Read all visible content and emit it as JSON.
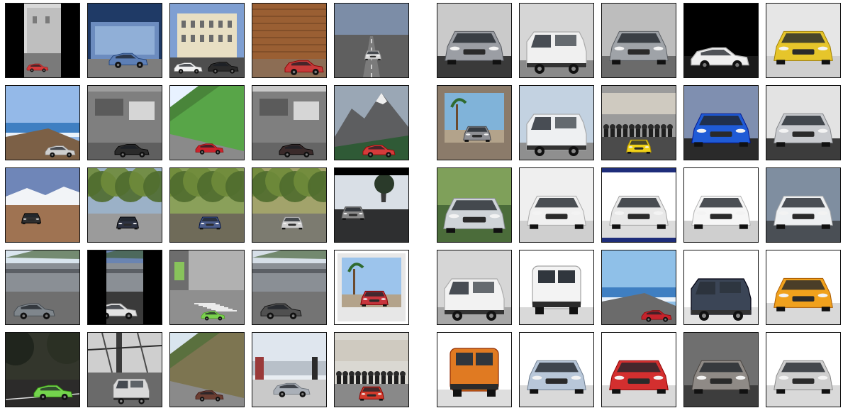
{
  "panels": [
    {
      "id": "left",
      "grid": [
        [
          {
            "scene": "castle-street",
            "sky": "#d9d9d9",
            "ground": "#7a7a7a",
            "car": "#d23a3a",
            "frame": "black-sides"
          },
          {
            "scene": "glass-building",
            "sky": "#1f3a66",
            "ground": "#7d7d7d",
            "car": "#5d7fb6"
          },
          {
            "scene": "palace",
            "sky": "#7f9fd2",
            "ground": "#4e4e4e",
            "car": "#f0f0f0"
          },
          {
            "scene": "wood-wall",
            "sky": "#7faee3",
            "ground": "#8c6d54",
            "car": "#c63a3a"
          },
          {
            "scene": "highway",
            "sky": "#7c8da7",
            "ground": "#5f5f5f",
            "car": "#d8d8d8"
          }
        ],
        [
          {
            "scene": "coast",
            "sky": "#94b9e8",
            "ground": "#7c6046",
            "car": "#cfcfcf"
          },
          {
            "scene": "concrete",
            "sky": "#9e9e9e",
            "ground": "#5f5f5f",
            "car": "#2b2b2b"
          },
          {
            "scene": "grass-hill",
            "sky": "#e8f2ff",
            "ground": "#58a548",
            "car": "#c9232c"
          },
          {
            "scene": "concrete",
            "sky": "#c9c9c9",
            "ground": "#656565",
            "car": "#3a2a2a"
          },
          {
            "scene": "mountain",
            "sky": "#9aa7b5",
            "ground": "#5b5b5b",
            "car": "#d43b3b"
          }
        ],
        [
          {
            "scene": "mountain-desert",
            "sky": "#6f86b8",
            "ground": "#9f7352",
            "car": "#303030"
          },
          {
            "scene": "forest-road",
            "sky": "#9bb1c7",
            "ground": "#9b9b9b",
            "car": "#2e3342"
          },
          {
            "scene": "forest-road",
            "sky": "#8aa05a",
            "ground": "#6f6b59",
            "car": "#4c5d8b"
          },
          {
            "scene": "forest-road",
            "sky": "#a2a36b",
            "ground": "#7c7b70",
            "car": "#cfcfcf"
          },
          {
            "scene": "dark-road",
            "sky": "#d9dfe6",
            "ground": "#2e2f30",
            "car": "#8a8a8a",
            "frame": "black-top"
          }
        ],
        [
          {
            "scene": "stadium",
            "sky": "#d9e5ee",
            "ground": "#6f6f6f",
            "car": "#7f868c"
          },
          {
            "scene": "stadium",
            "sky": "#6a84b2",
            "ground": "#3a3a3a",
            "car": "#e2e2e2",
            "frame": "black-sides"
          },
          {
            "scene": "hangar",
            "sky": "#b1b1b1",
            "ground": "#8f8f8f",
            "car": "#79d14d"
          },
          {
            "scene": "stadium",
            "sky": "#d6dfe8",
            "ground": "#747474",
            "car": "#505050"
          },
          {
            "scene": "palm-photo",
            "sky": "#9cc4ec",
            "ground": "#e7e7e7",
            "car": "#c8353d",
            "frame": "white"
          }
        ],
        [
          {
            "scene": "night-road",
            "sky": "#33362c",
            "ground": "#2c2b2a",
            "car": "#74d44d"
          },
          {
            "scene": "bw-industrial",
            "sky": "#cfcfcf",
            "ground": "#6a6a6a",
            "car": "#d9d9d9"
          },
          {
            "scene": "grass-hill",
            "sky": "#d9e5ee",
            "ground": "#7d7551",
            "car": "#6b3e32"
          },
          {
            "scene": "showroom",
            "sky": "#e8edf2",
            "ground": "#c9c9c9",
            "car": "#aab0b8"
          },
          {
            "scene": "crowd",
            "sky": "#dad8d2",
            "ground": "#898989",
            "car": "#d23a2b"
          }
        ]
      ]
    },
    {
      "id": "right",
      "grid": [
        [
          {
            "scene": "studio-front",
            "sky": "#cacaca",
            "ground": "#3a3a3a",
            "car": "#9b9ea4"
          },
          {
            "scene": "van-side",
            "sky": "#d6d6d6",
            "ground": "#8a8a8a",
            "car": "#f0f0f0"
          },
          {
            "scene": "studio-front",
            "sky": "#bdbdbd",
            "ground": "#6b6b6b",
            "car": "#9fa3a8"
          },
          {
            "scene": "studio-dark",
            "sky": "#000000",
            "ground": "#1a1a1a",
            "car": "#efefef"
          },
          {
            "scene": "studio-front",
            "sky": "#e6e6e6",
            "ground": "#cfcfcf",
            "car": "#e6c52b"
          }
        ],
        [
          {
            "scene": "palm-photo",
            "sky": "#80b3d9",
            "ground": "#8b7b6a",
            "car": "#8e8f94"
          },
          {
            "scene": "van-side",
            "sky": "#c3d2e1",
            "ground": "#8f8f8f",
            "car": "#eef0f2"
          },
          {
            "scene": "crowd",
            "sky": "#9b9b9b",
            "ground": "#4b4b4b",
            "car": "#f0d219"
          },
          {
            "scene": "studio-front",
            "sky": "#7f8fb0",
            "ground": "#2a2a2a",
            "car": "#1f5bd6"
          },
          {
            "scene": "studio-front",
            "sky": "#e3e3e3",
            "ground": "#3c3c3c",
            "car": "#c9cbcf"
          }
        ],
        [
          {
            "scene": "garden",
            "sky": "#7fa05a",
            "ground": "#4b6c3a",
            "car": "#cfd4d8"
          },
          {
            "scene": "studio-front",
            "sky": "#efefef",
            "ground": "#cfcfcf",
            "car": "#f0f0f0"
          },
          {
            "scene": "studio-front",
            "sky": "#ffffff",
            "ground": "#dcdcdc",
            "car": "#e8e8e8",
            "frame": "blue-bar"
          },
          {
            "scene": "studio-front",
            "sky": "#ffffff",
            "ground": "#cfcfcf",
            "car": "#f6f6f6"
          },
          {
            "scene": "studio-front",
            "sky": "#7f8ea0",
            "ground": "#4a4f55",
            "car": "#eef0f2"
          }
        ],
        [
          {
            "scene": "van-side",
            "sky": "#d6d6d6",
            "ground": "#a7a7a7",
            "car": "#f2f2f2"
          },
          {
            "scene": "van-rear",
            "sky": "#ffffff",
            "ground": "#d9d9d9",
            "car": "#f3f3f3"
          },
          {
            "scene": "coast",
            "sky": "#8fc0e8",
            "ground": "#6b6b6b",
            "car": "#c5232c"
          },
          {
            "scene": "van-side",
            "sky": "#ffffff",
            "ground": "#e2e2e2",
            "car": "#3b4556"
          },
          {
            "scene": "studio-front",
            "sky": "#ffffff",
            "ground": "#d9d9d9",
            "car": "#f0a11d"
          }
        ],
        [
          {
            "scene": "van-rear",
            "sky": "#ffffff",
            "ground": "#dedede",
            "car": "#e07a22"
          },
          {
            "scene": "studio-front",
            "sky": "#ffffff",
            "ground": "#d9d9d9",
            "car": "#b8c7d9"
          },
          {
            "scene": "studio-front",
            "sky": "#ffffff",
            "ground": "#d9d9d9",
            "car": "#d32f2f"
          },
          {
            "scene": "studio-front",
            "sky": "#6f6f6f",
            "ground": "#3d3d3d",
            "car": "#8f8a86"
          },
          {
            "scene": "studio-front",
            "sky": "#ffffff",
            "ground": "#d9d9d9",
            "car": "#cfcfcf"
          }
        ]
      ]
    }
  ]
}
